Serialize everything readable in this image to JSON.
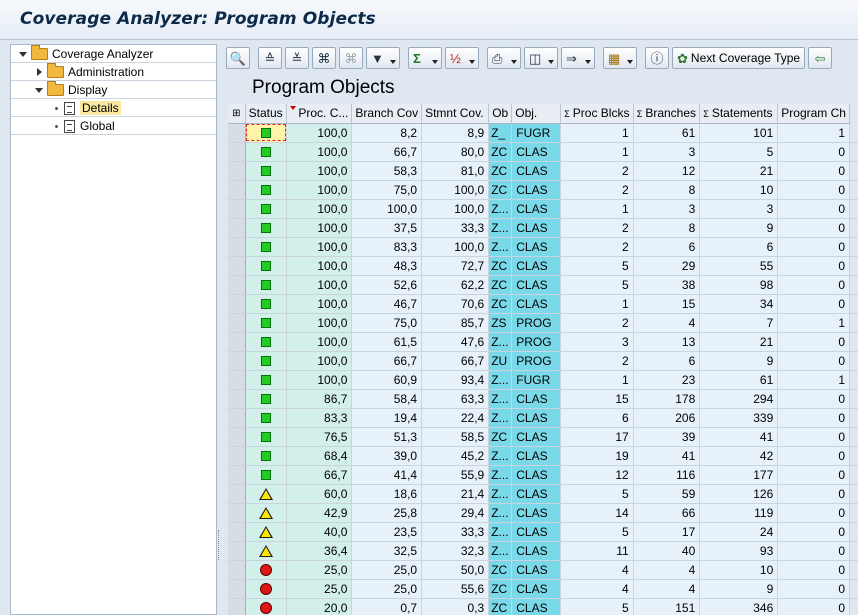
{
  "window": {
    "title": "Coverage Analyzer: Program Objects"
  },
  "tree": {
    "items": [
      {
        "label": "Coverage Analyzer",
        "level": 0,
        "expanded": true
      },
      {
        "label": "Administration",
        "level": 1,
        "expanded": false
      },
      {
        "label": "Display",
        "level": 1,
        "expanded": true
      },
      {
        "label": "Details",
        "level": 2,
        "selected": true
      },
      {
        "label": "Global",
        "level": 2,
        "selected": false
      }
    ]
  },
  "toolbar": {
    "next_coverage_type_label": "Next Coverage Type"
  },
  "page_title": "Program Objects",
  "table": {
    "headers": [
      "Status",
      "Proc. C...",
      "Branch Cov",
      "Stmnt Cov.",
      "Ob",
      "Obj.",
      "Proc Blcks",
      "Branches",
      "Statements",
      "Program Ch"
    ],
    "rows": [
      {
        "status": "green",
        "proc_cov": "100,0",
        "branch_cov": "8,2",
        "stmnt_cov": "8,9",
        "ob": "Z_",
        "obj": "FUGR",
        "proc_blcks": "1",
        "branches": "61",
        "statements": "101",
        "prog_ch": "1"
      },
      {
        "status": "green",
        "proc_cov": "100,0",
        "branch_cov": "66,7",
        "stmnt_cov": "80,0",
        "ob": "ZC",
        "obj": "CLAS",
        "proc_blcks": "1",
        "branches": "3",
        "statements": "5",
        "prog_ch": "0"
      },
      {
        "status": "green",
        "proc_cov": "100,0",
        "branch_cov": "58,3",
        "stmnt_cov": "81,0",
        "ob": "ZC",
        "obj": "CLAS",
        "proc_blcks": "2",
        "branches": "12",
        "statements": "21",
        "prog_ch": "0"
      },
      {
        "status": "green",
        "proc_cov": "100,0",
        "branch_cov": "75,0",
        "stmnt_cov": "100,0",
        "ob": "ZC",
        "obj": "CLAS",
        "proc_blcks": "2",
        "branches": "8",
        "statements": "10",
        "prog_ch": "0"
      },
      {
        "status": "green",
        "proc_cov": "100,0",
        "branch_cov": "100,0",
        "stmnt_cov": "100,0",
        "ob": "Z...",
        "obj": "CLAS",
        "proc_blcks": "1",
        "branches": "3",
        "statements": "3",
        "prog_ch": "0"
      },
      {
        "status": "green",
        "proc_cov": "100,0",
        "branch_cov": "37,5",
        "stmnt_cov": "33,3",
        "ob": "Z...",
        "obj": "CLAS",
        "proc_blcks": "2",
        "branches": "8",
        "statements": "9",
        "prog_ch": "0"
      },
      {
        "status": "green",
        "proc_cov": "100,0",
        "branch_cov": "83,3",
        "stmnt_cov": "100,0",
        "ob": "Z...",
        "obj": "CLAS",
        "proc_blcks": "2",
        "branches": "6",
        "statements": "6",
        "prog_ch": "0"
      },
      {
        "status": "green",
        "proc_cov": "100,0",
        "branch_cov": "48,3",
        "stmnt_cov": "72,7",
        "ob": "ZC",
        "obj": "CLAS",
        "proc_blcks": "5",
        "branches": "29",
        "statements": "55",
        "prog_ch": "0"
      },
      {
        "status": "green",
        "proc_cov": "100,0",
        "branch_cov": "52,6",
        "stmnt_cov": "62,2",
        "ob": "ZC",
        "obj": "CLAS",
        "proc_blcks": "5",
        "branches": "38",
        "statements": "98",
        "prog_ch": "0"
      },
      {
        "status": "green",
        "proc_cov": "100,0",
        "branch_cov": "46,7",
        "stmnt_cov": "70,6",
        "ob": "ZC",
        "obj": "CLAS",
        "proc_blcks": "1",
        "branches": "15",
        "statements": "34",
        "prog_ch": "0"
      },
      {
        "status": "green",
        "proc_cov": "100,0",
        "branch_cov": "75,0",
        "stmnt_cov": "85,7",
        "ob": "ZS",
        "obj": "PROG",
        "proc_blcks": "2",
        "branches": "4",
        "statements": "7",
        "prog_ch": "1"
      },
      {
        "status": "green",
        "proc_cov": "100,0",
        "branch_cov": "61,5",
        "stmnt_cov": "47,6",
        "ob": "Z...",
        "obj": "PROG",
        "proc_blcks": "3",
        "branches": "13",
        "statements": "21",
        "prog_ch": "0"
      },
      {
        "status": "green",
        "proc_cov": "100,0",
        "branch_cov": "66,7",
        "stmnt_cov": "66,7",
        "ob": "ZU",
        "obj": "PROG",
        "proc_blcks": "2",
        "branches": "6",
        "statements": "9",
        "prog_ch": "0"
      },
      {
        "status": "green",
        "proc_cov": "100,0",
        "branch_cov": "60,9",
        "stmnt_cov": "93,4",
        "ob": "Z...",
        "obj": "FUGR",
        "proc_blcks": "1",
        "branches": "23",
        "statements": "61",
        "prog_ch": "1"
      },
      {
        "status": "green",
        "proc_cov": "86,7",
        "branch_cov": "58,4",
        "stmnt_cov": "63,3",
        "ob": "Z...",
        "obj": "CLAS",
        "proc_blcks": "15",
        "branches": "178",
        "statements": "294",
        "prog_ch": "0"
      },
      {
        "status": "green",
        "proc_cov": "83,3",
        "branch_cov": "19,4",
        "stmnt_cov": "22,4",
        "ob": "Z...",
        "obj": "CLAS",
        "proc_blcks": "6",
        "branches": "206",
        "statements": "339",
        "prog_ch": "0"
      },
      {
        "status": "green",
        "proc_cov": "76,5",
        "branch_cov": "51,3",
        "stmnt_cov": "58,5",
        "ob": "ZC",
        "obj": "CLAS",
        "proc_blcks": "17",
        "branches": "39",
        "statements": "41",
        "prog_ch": "0"
      },
      {
        "status": "green",
        "proc_cov": "68,4",
        "branch_cov": "39,0",
        "stmnt_cov": "45,2",
        "ob": "Z...",
        "obj": "CLAS",
        "proc_blcks": "19",
        "branches": "41",
        "statements": "42",
        "prog_ch": "0"
      },
      {
        "status": "green",
        "proc_cov": "66,7",
        "branch_cov": "41,4",
        "stmnt_cov": "55,9",
        "ob": "Z...",
        "obj": "CLAS",
        "proc_blcks": "12",
        "branches": "116",
        "statements": "177",
        "prog_ch": "0"
      },
      {
        "status": "yellow",
        "proc_cov": "60,0",
        "branch_cov": "18,6",
        "stmnt_cov": "21,4",
        "ob": "Z...",
        "obj": "CLAS",
        "proc_blcks": "5",
        "branches": "59",
        "statements": "126",
        "prog_ch": "0"
      },
      {
        "status": "yellow",
        "proc_cov": "42,9",
        "branch_cov": "25,8",
        "stmnt_cov": "29,4",
        "ob": "Z...",
        "obj": "CLAS",
        "proc_blcks": "14",
        "branches": "66",
        "statements": "119",
        "prog_ch": "0"
      },
      {
        "status": "yellow",
        "proc_cov": "40,0",
        "branch_cov": "23,5",
        "stmnt_cov": "33,3",
        "ob": "Z...",
        "obj": "CLAS",
        "proc_blcks": "5",
        "branches": "17",
        "statements": "24",
        "prog_ch": "0"
      },
      {
        "status": "yellow",
        "proc_cov": "36,4",
        "branch_cov": "32,5",
        "stmnt_cov": "32,3",
        "ob": "Z...",
        "obj": "CLAS",
        "proc_blcks": "11",
        "branches": "40",
        "statements": "93",
        "prog_ch": "0"
      },
      {
        "status": "red",
        "proc_cov": "25,0",
        "branch_cov": "25,0",
        "stmnt_cov": "50,0",
        "ob": "ZC",
        "obj": "CLAS",
        "proc_blcks": "4",
        "branches": "4",
        "statements": "10",
        "prog_ch": "0"
      },
      {
        "status": "red",
        "proc_cov": "25,0",
        "branch_cov": "25,0",
        "stmnt_cov": "55,6",
        "ob": "ZC",
        "obj": "CLAS",
        "proc_blcks": "4",
        "branches": "4",
        "statements": "9",
        "prog_ch": "0"
      },
      {
        "status": "red",
        "proc_cov": "20,0",
        "branch_cov": "0,7",
        "stmnt_cov": "0,3",
        "ob": "ZC",
        "obj": "CLAS",
        "proc_blcks": "5",
        "branches": "151",
        "statements": "346",
        "prog_ch": "0"
      }
    ]
  }
}
